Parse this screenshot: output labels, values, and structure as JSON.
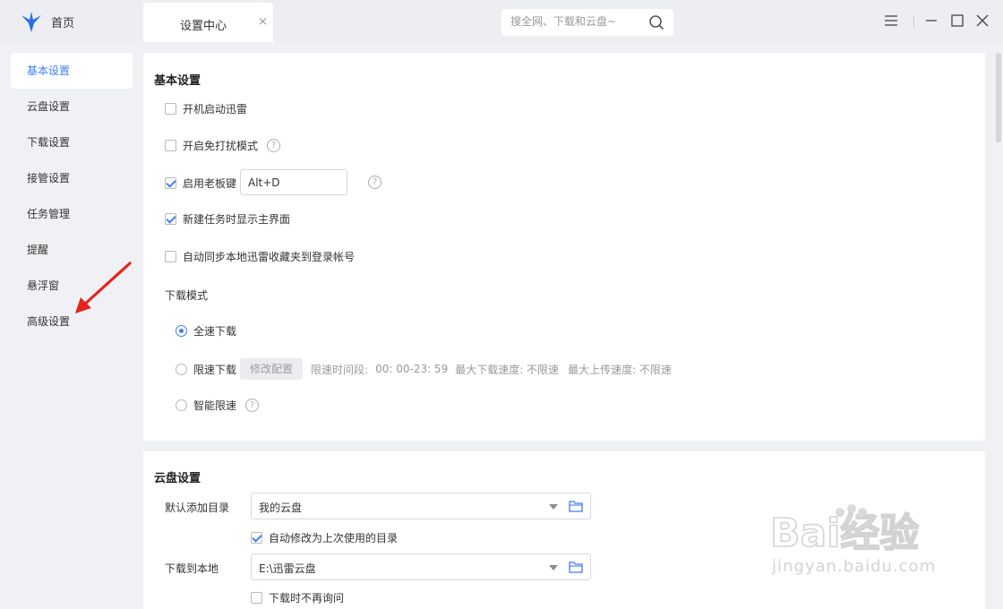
{
  "titlebar": {
    "home_label": "首页",
    "active_tab_label": "设置中心",
    "tab_close_glyph": "×",
    "search_placeholder": "搜全网、下载和云盘~",
    "brand_color": "#2a6ee8"
  },
  "sidebar": {
    "items": [
      {
        "label": "基本设置",
        "active": true
      },
      {
        "label": "云盘设置",
        "active": false
      },
      {
        "label": "下载设置",
        "active": false
      },
      {
        "label": "接管设置",
        "active": false
      },
      {
        "label": "任务管理",
        "active": false
      },
      {
        "label": "提醒",
        "active": false
      },
      {
        "label": "悬浮窗",
        "active": false
      },
      {
        "label": "高级设置",
        "active": false
      }
    ],
    "accent_color": "#3f7ef5",
    "annotation_color": "#e3231e"
  },
  "basic": {
    "title": "基本设置",
    "options": [
      {
        "label": "开机启动迅雷",
        "checked": false
      },
      {
        "label": "开启免打扰模式",
        "checked": false
      },
      {
        "label": "启用老板键",
        "checked": true
      },
      {
        "label": "新建任务时显示主界面",
        "checked": true
      },
      {
        "label": "自动同步本地迅雷收藏夹到登录帐号",
        "checked": false
      }
    ],
    "hotkey_value": "Alt+D",
    "help_glyph": "?",
    "download_mode": {
      "title": "下载模式",
      "full_speed": "全速下载",
      "limited": "限速下载",
      "modify_button": "修改配置",
      "limit_period": "限速时间段:",
      "limit_period_value": "00: 00-23: 59",
      "max_download": "最大下载速度: 不限速",
      "max_upload": "最大上传速度: 不限速",
      "smart": "智能限速",
      "selected": "全速下载"
    }
  },
  "cloud": {
    "title": "云盘设置",
    "default_dir_label": "默认添加目录",
    "default_dir_value": "我的云盘",
    "auto_modify_label": "自动修改为上次使用的目录",
    "auto_modify_checked": true,
    "download_local_label": "下载到本地",
    "download_local_value": "E:\\迅雷云盘",
    "no_ask_label": "下载时不再询问",
    "no_ask_checked": false
  },
  "watermark": {
    "logo_text": "Bai经验",
    "url": "jingyan.baidu.com"
  },
  "icons": [
    "xunlei-logo-icon",
    "search-icon",
    "menu-icon",
    "minimize-icon",
    "maximize-icon",
    "close-icon",
    "help-icon",
    "folder-icon",
    "caret-down-icon",
    "red-arrow-icon",
    "baidu-paw-icon"
  ]
}
